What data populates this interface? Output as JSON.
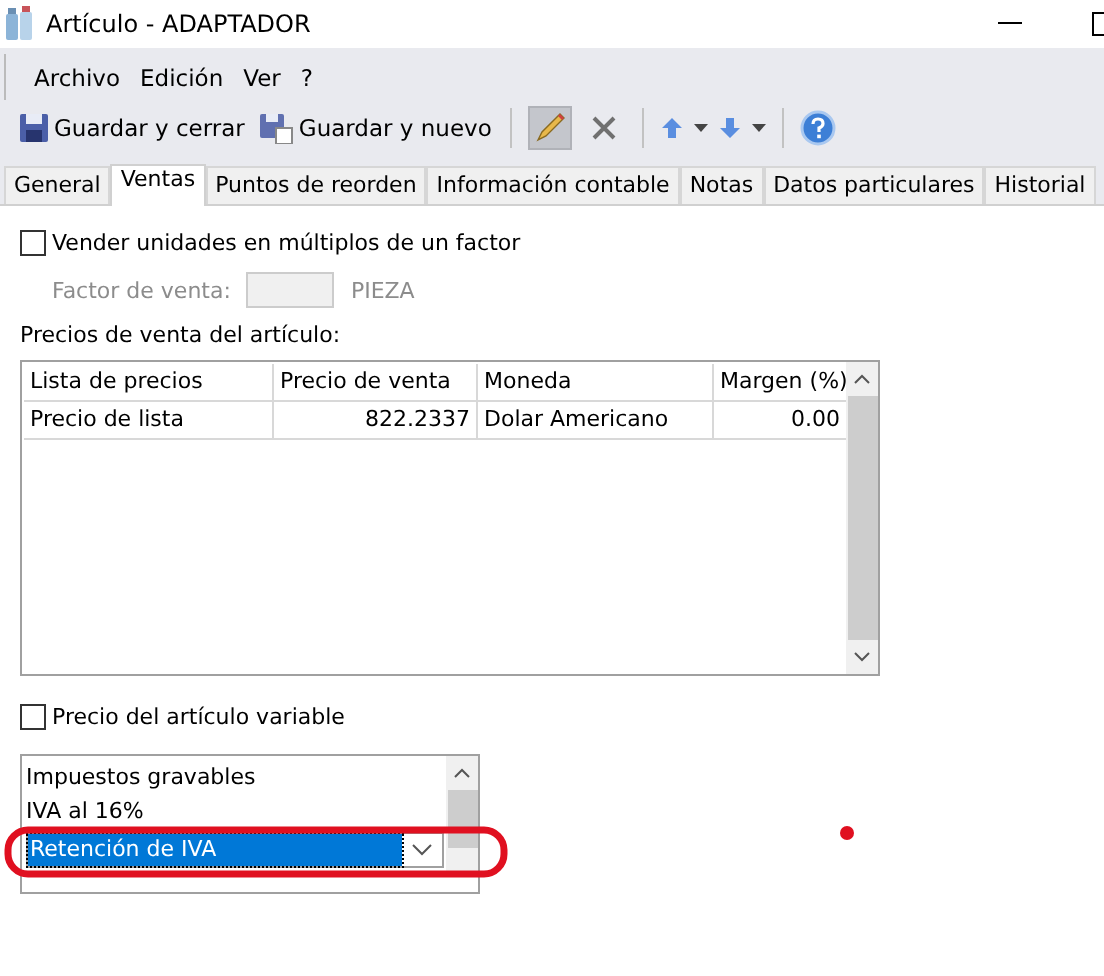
{
  "window": {
    "title": "Artículo - ADAPTADOR"
  },
  "menu": [
    "Archivo",
    "Edición",
    "Ver",
    "?"
  ],
  "toolbar": {
    "save_close": "Guardar y cerrar",
    "save_new": "Guardar y nuevo",
    "edit_selected": true
  },
  "tabs": [
    {
      "label": "General",
      "selected": false
    },
    {
      "label": "Ventas",
      "selected": true
    },
    {
      "label": "Puntos de reorden",
      "selected": false
    },
    {
      "label": "Información contable",
      "selected": false
    },
    {
      "label": "Notas",
      "selected": false
    },
    {
      "label": "Datos particulares",
      "selected": false
    },
    {
      "label": "Historial",
      "selected": false
    }
  ],
  "multiples": {
    "label": "Vender unidades en múltiplos de un factor",
    "checked": false
  },
  "factor": {
    "label": "Factor de venta:",
    "unit": "PIEZA",
    "disabled": true
  },
  "prices": {
    "label": "Precios de venta del artículo:",
    "columns": [
      "Lista de precios",
      "Precio de venta",
      "Moneda",
      "Margen (%)"
    ],
    "rows": [
      [
        "Precio de lista",
        "822.2337",
        "Dolar Americano",
        "0.00"
      ]
    ]
  },
  "variable": {
    "label": "Precio del artículo variable",
    "checked": false
  },
  "taxes": {
    "items": [
      {
        "label": "Impuestos gravables",
        "kind": "header"
      },
      {
        "label": "IVA al 16%",
        "kind": "text"
      },
      {
        "label": "Retención de IVA",
        "kind": "combo"
      }
    ]
  }
}
